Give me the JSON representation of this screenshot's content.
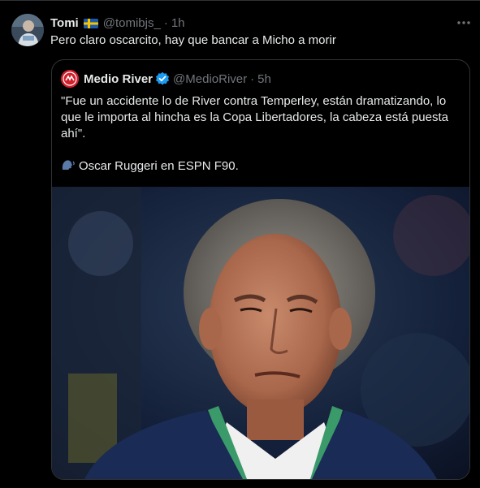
{
  "tweet": {
    "display_name": "Tomi",
    "handle": "@tomibjs_",
    "separator": "·",
    "time": "1h",
    "text": "Pero claro oscarcito, hay que bancar a Micho a morir",
    "flag_icon": "sweden-flag-icon",
    "more_icon": "more-options-icon"
  },
  "quote": {
    "display_name": "Medio River",
    "handle": "@MedioRiver",
    "separator": "·",
    "time": "5h",
    "verified_icon": "verified-badge-icon",
    "line1": "\"Fue un accidente lo de River contra Temperley, están dramatizando, lo que le importa al hincha es la Copa Libertadores, la cabeza está puesta ahí\".",
    "line2": "Oscar Ruggeri en ESPN F90.",
    "speaker_icon": "speaking-head-icon"
  },
  "colors": {
    "background": "#000000",
    "text": "#e7e9ea",
    "secondary": "#71767b",
    "border": "#2f3336",
    "verified": "#1d9bf0",
    "brand_red": "#d0202c"
  }
}
